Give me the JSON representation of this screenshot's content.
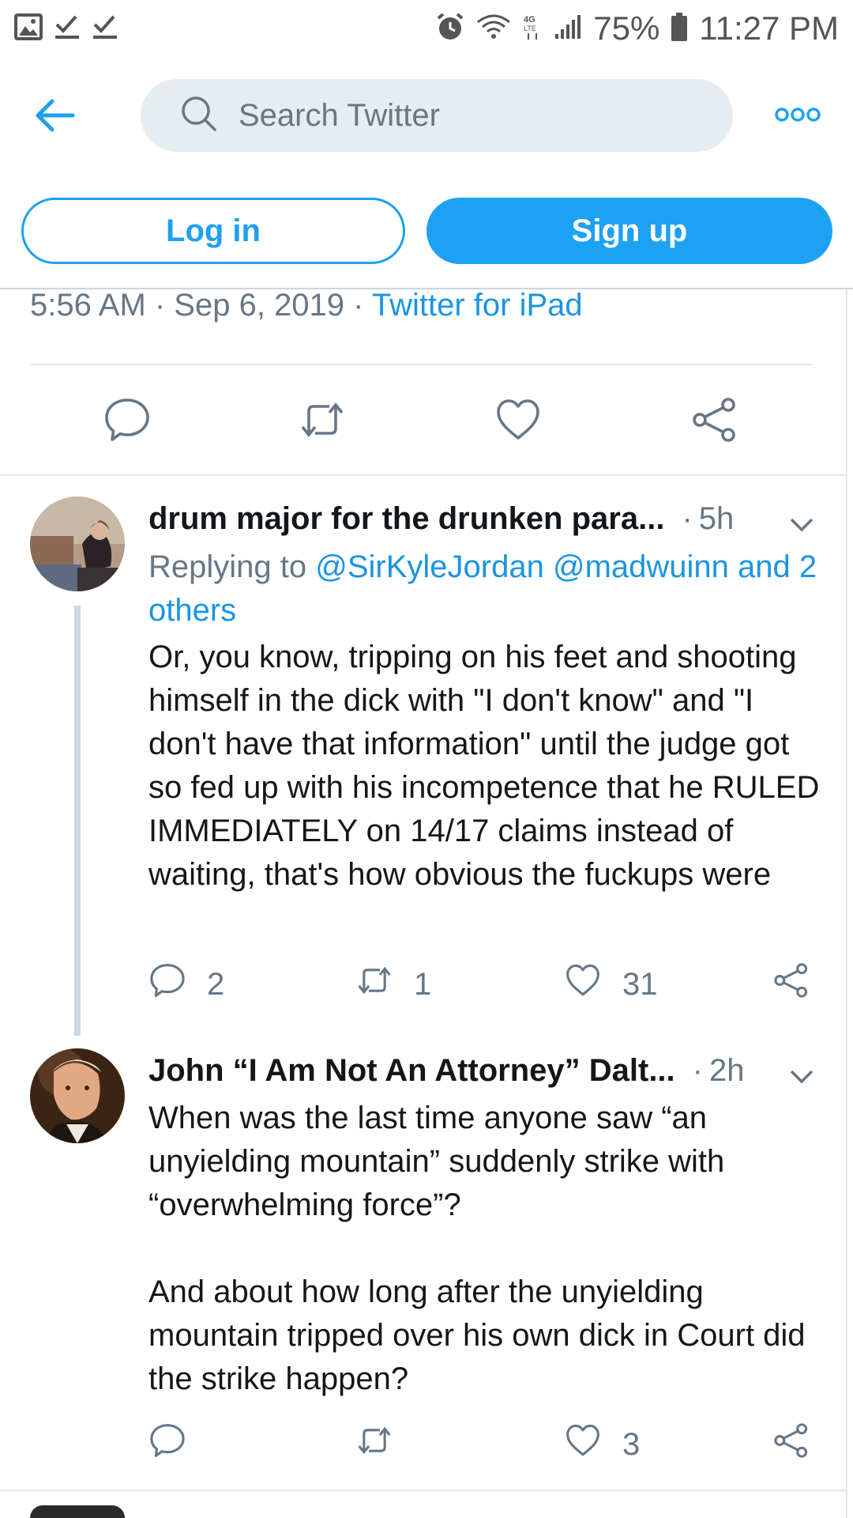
{
  "status_bar": {
    "battery": "75%",
    "time": "11:27 PM",
    "network": "4G LTE",
    "icons_left": [
      "image-icon",
      "check-icon",
      "check-icon"
    ],
    "icons_right": [
      "alarm-icon",
      "wifi-icon",
      "lte-icon",
      "signal-icon",
      "battery-icon"
    ]
  },
  "header": {
    "search_placeholder": "Search Twitter",
    "login_label": "Log in",
    "signup_label": "Sign up"
  },
  "colors": {
    "accent": "#1da1f2",
    "link": "#1b95e0",
    "secondary_text": "#657786",
    "divider": "#e1e8ed"
  },
  "main_tweet": {
    "timestamp": "5:56 AM · Sep 6, 2019 · ",
    "source": "Twitter for iPad",
    "actions": [
      "reply-icon",
      "retweet-icon",
      "like-icon",
      "share-icon"
    ]
  },
  "replies": [
    {
      "name": "drum major for the drunken para...",
      "separator": "·",
      "time": "5h",
      "replying_prefix": "Replying to ",
      "replying_handles": "@SirKyleJordan @madwuinn and 2 others",
      "text": "Or, you know, tripping on his feet and shooting himself in the dick with \"I don't know\" and \"I don't have that information\" until the judge got so fed up with his incompetence that he RULED IMMEDIATELY on 14/17 claims instead of waiting, that's how obvious the fuckups were",
      "reply_count": "2",
      "retweet_count": "1",
      "like_count": "31"
    },
    {
      "name": "John “I Am Not An Attorney” Dalt...",
      "separator": "·",
      "time": "2h",
      "text": "When was the last time anyone saw “an unyielding mountain” suddenly strike with “overwhelming force”?\n\nAnd about how long after the unyielding mountain tripped over his own dick in Court did the strike happen?",
      "reply_count": "",
      "retweet_count": "",
      "like_count": "3"
    }
  ]
}
